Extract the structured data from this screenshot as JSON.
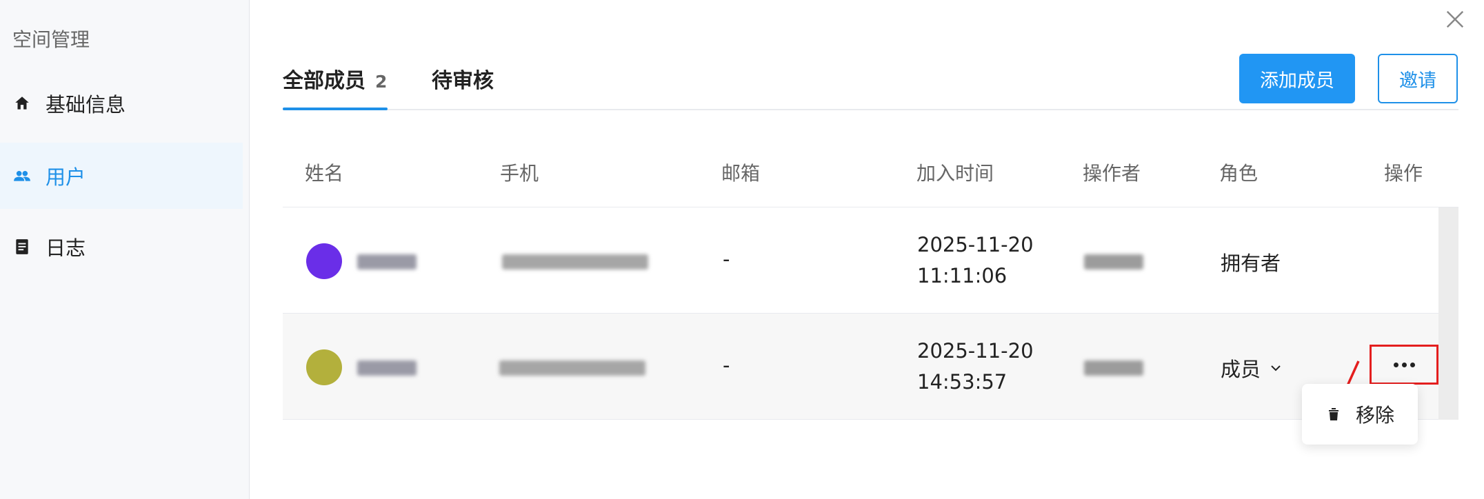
{
  "sidebar": {
    "title": "空间管理",
    "items": [
      {
        "label": "基础信息",
        "icon": "home-icon"
      },
      {
        "label": "用户",
        "icon": "users-icon",
        "active": true
      },
      {
        "label": "日志",
        "icon": "log-icon"
      }
    ]
  },
  "tabs": {
    "all_label": "全部成员",
    "all_count": "2",
    "pending_label": "待审核"
  },
  "buttons": {
    "add_member": "添加成员",
    "invite": "邀请"
  },
  "table": {
    "headers": [
      "姓名",
      "手机",
      "邮箱",
      "加入时间",
      "操作者",
      "角色",
      "操作"
    ],
    "rows": [
      {
        "email": "-",
        "date": "2025-11-20",
        "time": "11:11:06",
        "role": "拥有者",
        "avatar_color": "#6a2ee8"
      },
      {
        "email": "-",
        "date": "2025-11-20",
        "time": "14:53:57",
        "role": "成员",
        "avatar_color": "#b3b03c"
      }
    ]
  },
  "menu": {
    "remove_label": "移除"
  },
  "colors": {
    "accent": "#1e90e8",
    "highlight": "#e41e1e"
  }
}
